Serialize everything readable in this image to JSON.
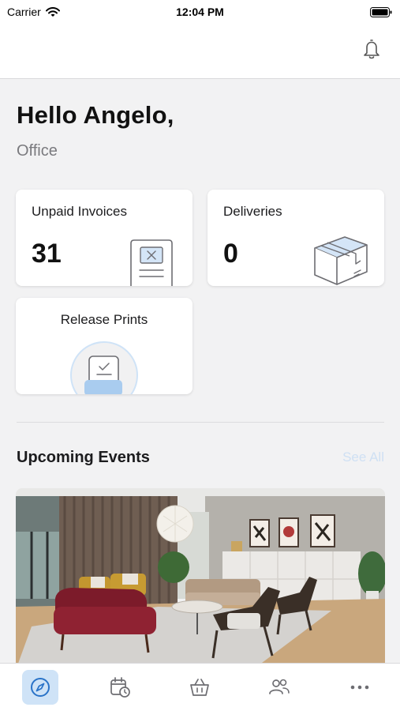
{
  "status_bar": {
    "carrier": "Carrier",
    "time": "12:04 PM"
  },
  "greeting": {
    "title": "Hello Angelo,",
    "location": "Office"
  },
  "cards": {
    "unpaid_invoices": {
      "label": "Unpaid Invoices",
      "value": "31"
    },
    "deliveries": {
      "label": "Deliveries",
      "value": "0"
    },
    "release_prints": {
      "label": "Release Prints"
    }
  },
  "events": {
    "title": "Upcoming Events",
    "see_all": "See All"
  },
  "tabs": [
    {
      "icon": "compass-icon",
      "active": true
    },
    {
      "icon": "calendar-clock-icon",
      "active": false
    },
    {
      "icon": "basket-icon",
      "active": false
    },
    {
      "icon": "people-icon",
      "active": false
    },
    {
      "icon": "more-icon",
      "active": false
    }
  ],
  "colors": {
    "accent": "#2a73c8",
    "accent_light": "#cfe3f7",
    "see_all": "#cfe0f3",
    "background": "#f2f2f3"
  }
}
